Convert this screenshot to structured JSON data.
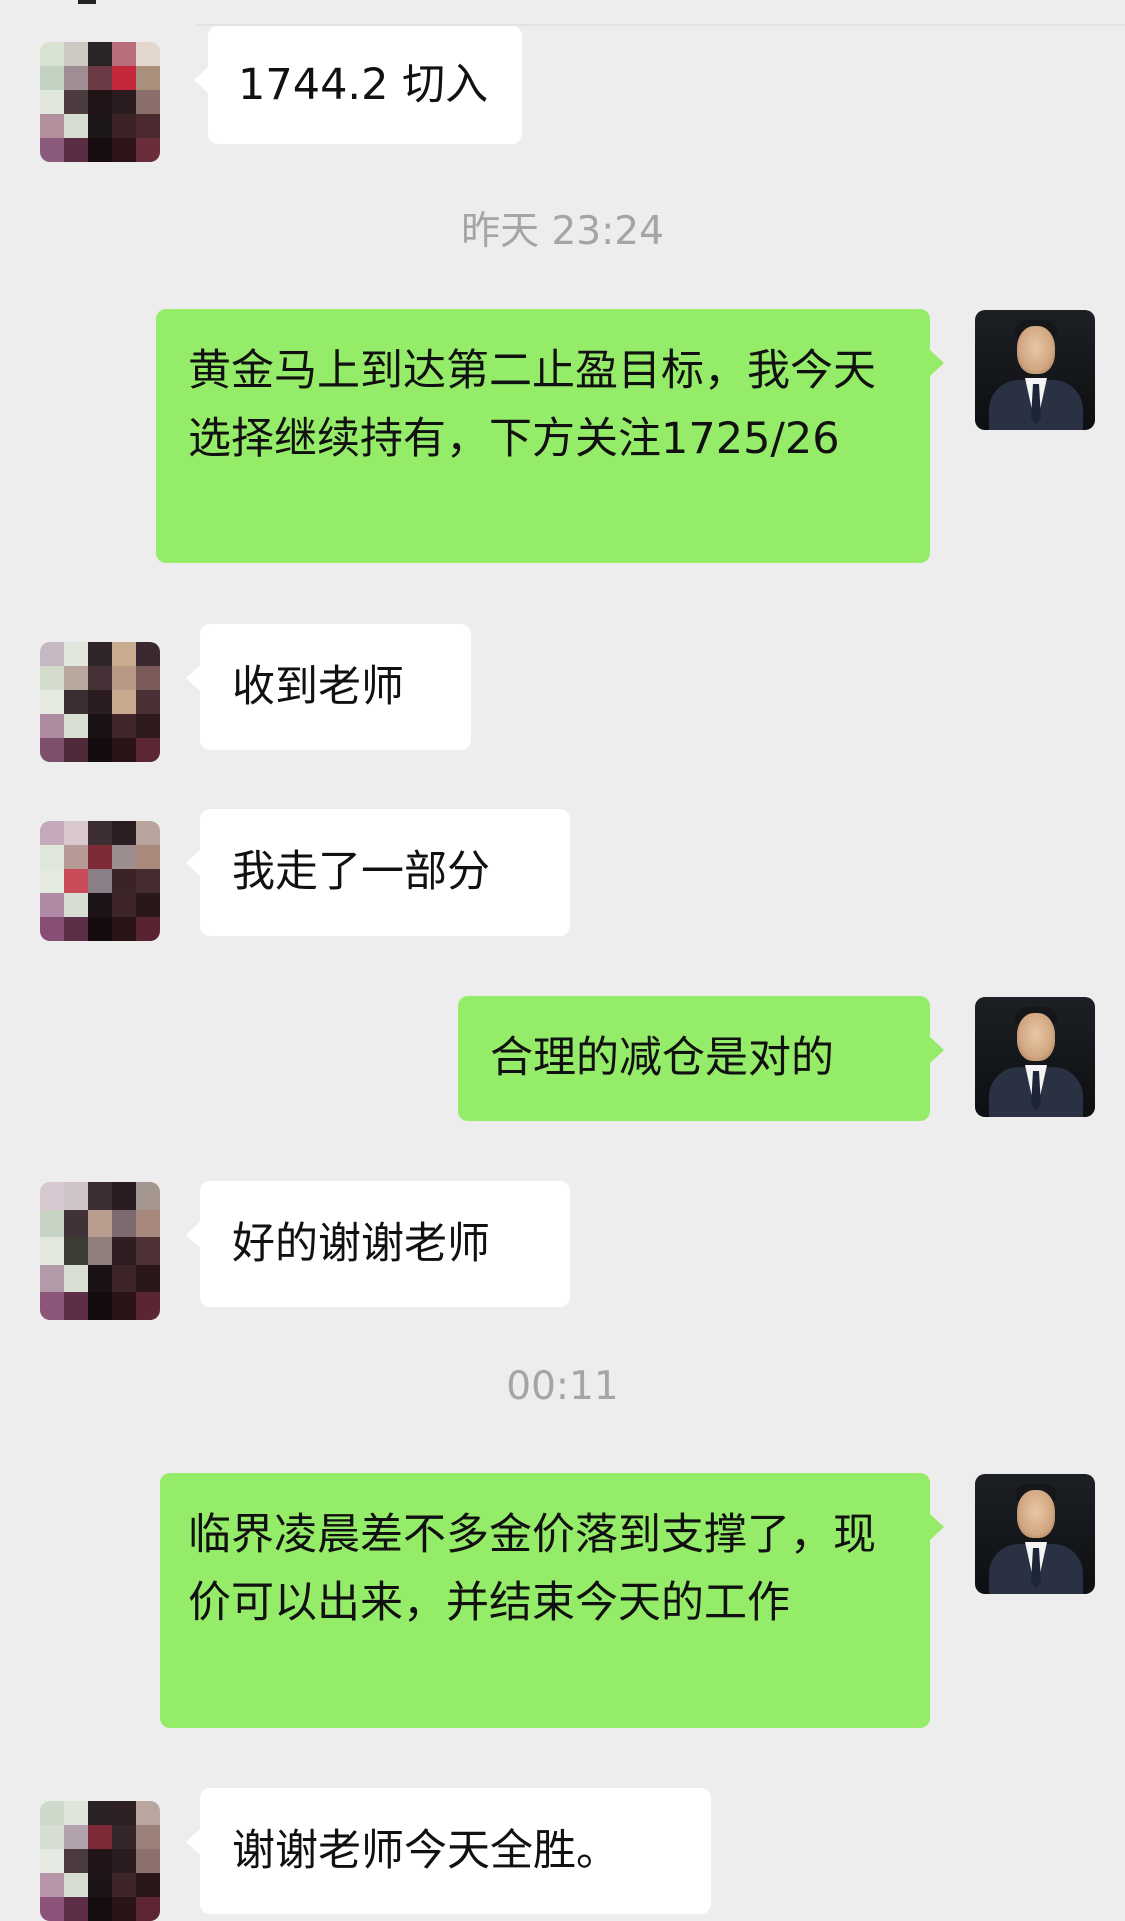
{
  "chat": {
    "messages": [
      {
        "text": "1744.2 切入"
      },
      {
        "text": "黄金马上到达第二止盈目标，我今天选择继续持有，下方关注1725/26"
      },
      {
        "text": "收到老师"
      },
      {
        "text": "我走了一部分"
      },
      {
        "text": "合理的减仓是对的"
      },
      {
        "text": "好的谢谢老师"
      },
      {
        "text": "临界凌晨差不多金价落到支撑了，现价可以出来，并结束今天的工作"
      },
      {
        "text": "谢谢老师今天全胜。"
      }
    ],
    "timestamps": [
      "昨天 23:24",
      "00:11"
    ]
  },
  "colors": {
    "background": "#ededed",
    "sent_bubble": "#95ec69",
    "received_bubble": "#ffffff",
    "timestamp_text": "#a5a5a5"
  },
  "icons": {
    "teacher_avatar": "teacher-avatar",
    "student_avatar": "pixelated-avatar"
  }
}
